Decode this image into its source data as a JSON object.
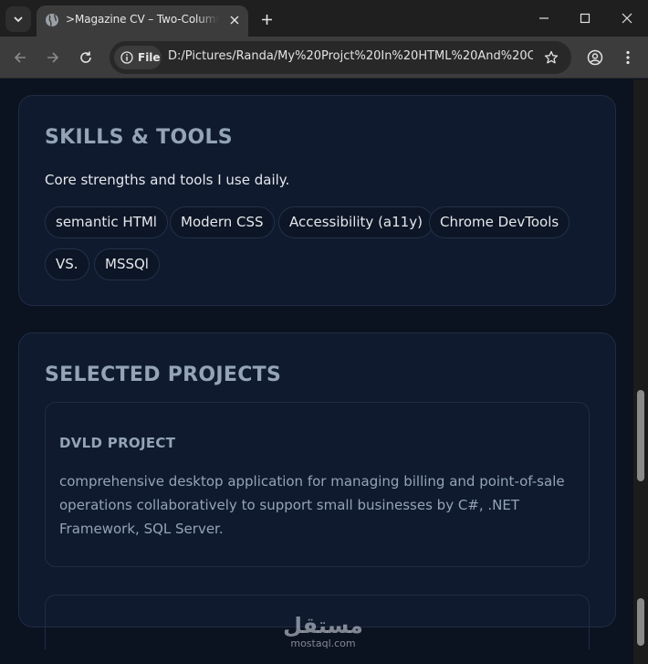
{
  "browser": {
    "tab": {
      "title": ">Magazine CV – Two-Column M"
    },
    "address": {
      "chip_label": "File",
      "url": "D:/Pictures/Randa/My%20Projct%20In%20HTML%20And%20C..."
    }
  },
  "skills": {
    "title": "SKILLS & TOOLS",
    "intro": "Core strengths and tools I use daily.",
    "tags": [
      "semantic HTMl",
      "Modern CSS",
      "Accessibility (a11y)",
      "Chrome DevTools",
      "VS.",
      "MSSQl"
    ]
  },
  "projects": {
    "title": "SELECTED PROJECTS",
    "items": [
      {
        "title": "DVLD PROJECT",
        "description": "comprehensive desktop application for managing billing and point-of-sale operations collaboratively to support small businesses by C#, .NET Framework, SQL Server."
      }
    ]
  },
  "watermark": {
    "mark": "مستقل",
    "domain": "mostaql.com"
  }
}
